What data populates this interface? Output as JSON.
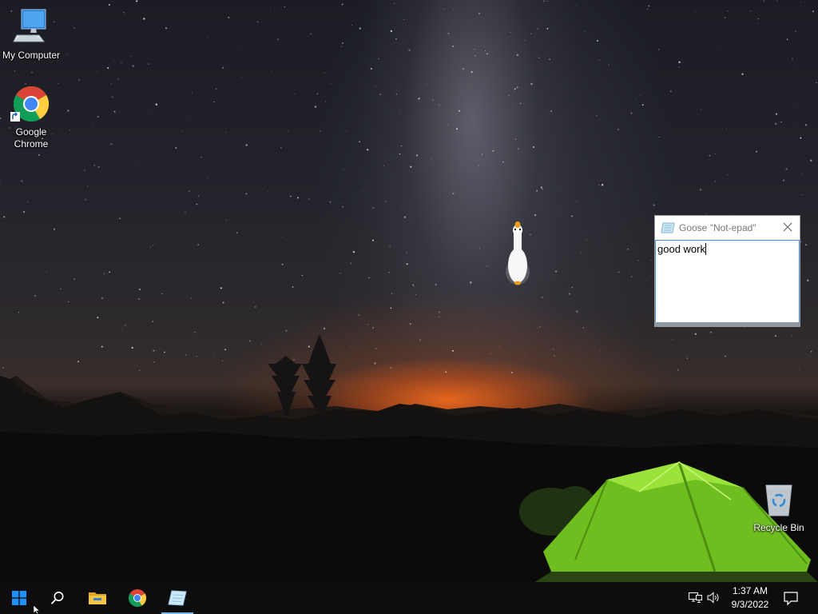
{
  "desktop": {
    "icons": [
      {
        "label": "My Computer",
        "icon": "computer-icon"
      },
      {
        "label": "Google\nChrome",
        "icon": "chrome-icon"
      },
      {
        "label": "Recycle Bin",
        "icon": "recycle-bin-icon"
      }
    ],
    "wallpaper": "night sky, milky way, mountains, green tent"
  },
  "goose_window": {
    "title": "Goose \"Not-epad\"",
    "text": "good work",
    "close_icon": "close-icon",
    "app_icon": "notepad-icon"
  },
  "taskbar": {
    "start_icon": "windows-logo-icon",
    "search_icon": "search-icon",
    "pinned": [
      {
        "name": "File Explorer",
        "icon": "folder-icon"
      },
      {
        "name": "Google Chrome",
        "icon": "chrome-icon"
      },
      {
        "name": "Goose Not-epad",
        "icon": "notepad-icon",
        "active": true
      }
    ],
    "tray": {
      "network_icon": "network-icon",
      "volume_icon": "volume-icon",
      "time": "1:37 AM",
      "date": "9/3/2022",
      "action_center_icon": "action-center-icon"
    }
  },
  "colors": {
    "taskbar": "#0d0d0e",
    "active_indicator": "#76b9ed",
    "text_border": "#4a8fd6",
    "tent": "#7ed321"
  }
}
